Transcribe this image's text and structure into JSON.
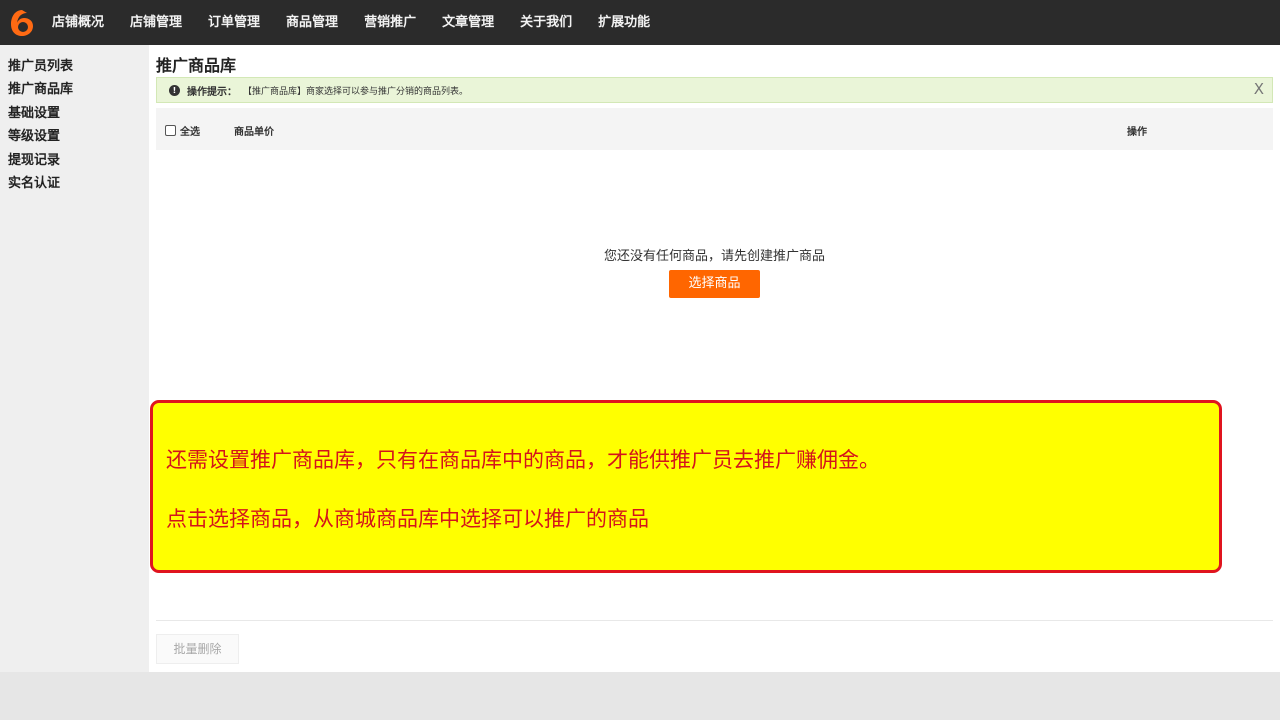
{
  "topnav": {
    "items": [
      {
        "label": "店铺概况"
      },
      {
        "label": "店铺管理"
      },
      {
        "label": "订单管理"
      },
      {
        "label": "商品管理"
      },
      {
        "label": "营销推广"
      },
      {
        "label": "文章管理"
      },
      {
        "label": "关于我们"
      },
      {
        "label": "扩展功能"
      }
    ]
  },
  "sidebar": {
    "items": [
      {
        "label": "推广员列表"
      },
      {
        "label": "推广商品库"
      },
      {
        "label": "基础设置"
      },
      {
        "label": "等级设置"
      },
      {
        "label": "提现记录"
      },
      {
        "label": "实名认证"
      }
    ]
  },
  "main": {
    "title": "推广商品库",
    "tip": {
      "icon": "!",
      "label": "操作提示：",
      "text": "【推广商品库】商家选择可以参与推广分销的商品列表。",
      "close": "X"
    },
    "table": {
      "select_all": "全选",
      "col_price": "商品单价",
      "col_op": "操作"
    },
    "empty_message": "您还没有任何商品，请先创建推广商品",
    "select_button": "选择商品",
    "batch_delete": "批量删除"
  },
  "callout": {
    "line1": "还需设置推广商品库，只有在商品库中的商品，才能供推广员去推广赚佣金。",
    "line2": "点击选择商品，从商城商品库中选择可以推广的商品"
  },
  "colors": {
    "topbar": "#2b2b2b",
    "accent": "#ff6600",
    "callout_bg": "#ffff00",
    "callout_text": "#d4141b"
  }
}
